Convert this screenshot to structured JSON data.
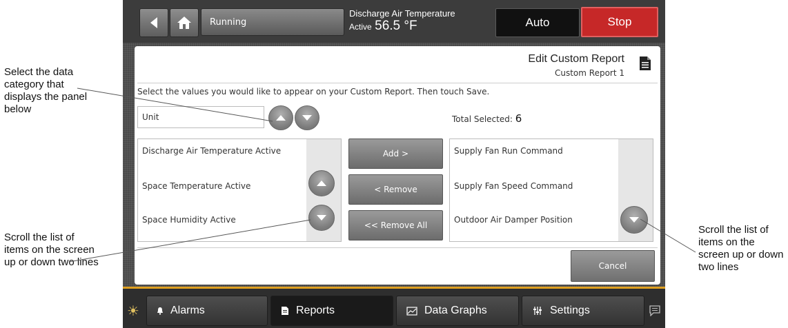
{
  "topbar": {
    "status": "Running",
    "readout_label": "Discharge Air Temperature",
    "readout_prefix": "Active",
    "readout_value": "56.5 °F",
    "auto_label": "Auto",
    "stop_label": "Stop"
  },
  "panel": {
    "title": "Edit Custom Report",
    "report_name": "Custom Report 1",
    "instructions": "Select the values you would like to appear on your Custom Report. Then touch Save.",
    "category": "Unit",
    "total_label": "Total Selected:",
    "total_count": "6",
    "available_items": [
      "Discharge Air Temperature Active",
      "Space Temperature Active",
      "Space Humidity Active"
    ],
    "selected_items": [
      "Supply Fan Run Command",
      "Supply Fan Speed Command",
      "Outdoor Air Damper Position"
    ],
    "add_label": "Add >",
    "remove_label": "< Remove",
    "remove_all_label": "<< Remove All",
    "cancel_label": "Cancel"
  },
  "nav": {
    "alarms": "Alarms",
    "reports": "Reports",
    "data_graphs": "Data Graphs",
    "settings": "Settings",
    "active": "Reports"
  },
  "callouts": {
    "category": "Select the data category that displays the panel below",
    "scroll_left": "Scroll the list of items on the screen up or down two lines",
    "scroll_right": "Scroll the list of items on the screen up or down two lines"
  },
  "icons": [
    "back-arrow-icon",
    "home-icon",
    "document-icon",
    "chevron-up-icon",
    "chevron-down-icon",
    "bell-icon",
    "report-icon",
    "graph-icon",
    "settings-sliders-icon",
    "sun-icon",
    "chat-icon"
  ],
  "colors": {
    "stop": "#c62828",
    "accent_line": "#e0a020"
  }
}
